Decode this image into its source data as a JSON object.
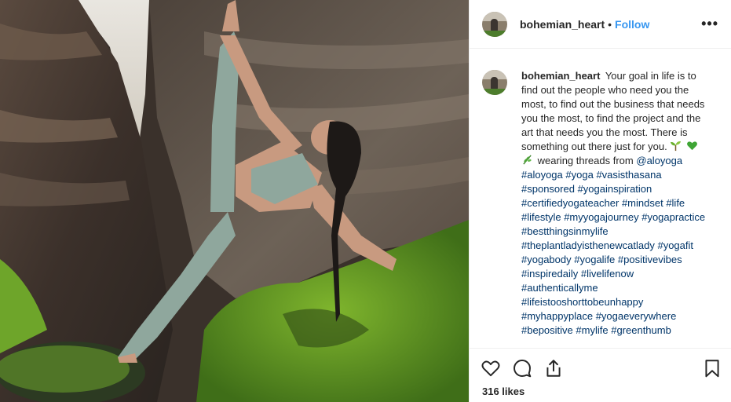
{
  "post": {
    "username": "bohemian_heart",
    "separator": "•",
    "follow_label": "Follow",
    "more_label": "•••",
    "caption_text": "Your goal in life is to find out the people who need you the most, to find out the business that needs you the most, to find the project and the art that needs you the most. There is something out there just for you.",
    "caption_after_emoji": "wearing threads from",
    "mention": "@aloyoga",
    "hashtags": [
      "#aloyoga",
      "#yoga",
      "#vasisthasana",
      "#sponsored",
      "#yogainspiration",
      "#certifiedyogateacher",
      "#mindset",
      "#life",
      "#lifestyle",
      "#myyogajourney",
      "#yogapractice",
      "#bestthingsinmylife",
      "#theplantladyisthenewcatlady",
      "#yogafit",
      "#yogabody",
      "#yogalife",
      "#positivevibes",
      "#inspiredaily",
      "#livelifenow",
      "#authenticallyme",
      "#lifeistooshorttobeunhappy",
      "#myhappyplace",
      "#yogaeverywhere",
      "#bepositive",
      "#mylife",
      "#greenthumb"
    ],
    "likes_text": "316 likes"
  },
  "icons": {
    "like": "heart-icon",
    "comment": "comment-icon",
    "share": "share-icon",
    "save": "bookmark-icon",
    "emojis": [
      "seedling-emoji",
      "green-heart-emoji",
      "herb-emoji"
    ]
  },
  "colors": {
    "link": "#3897f0",
    "hashtag": "#003569",
    "moss": "#4e8a23",
    "leggings": "#8fa79d"
  }
}
